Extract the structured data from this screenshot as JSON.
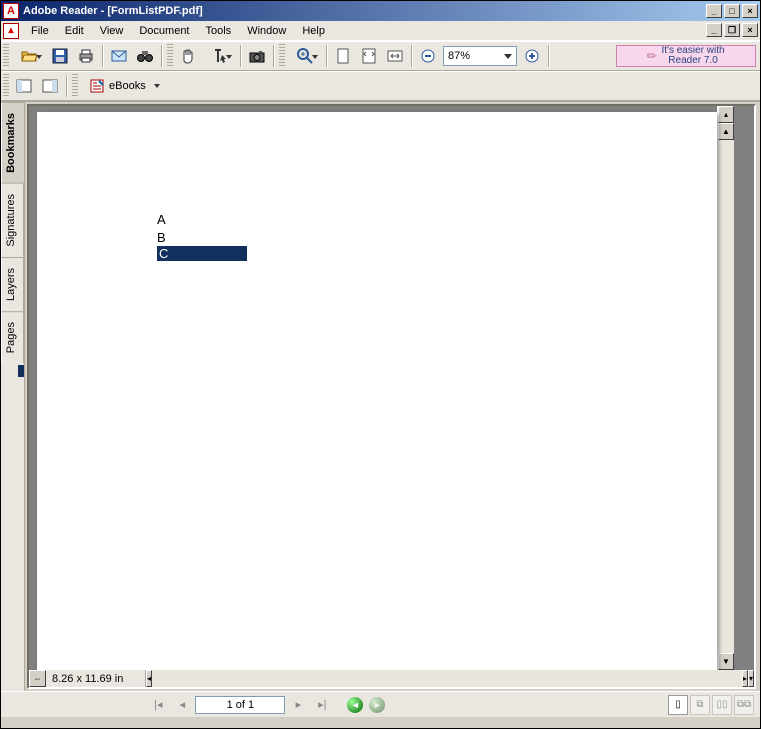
{
  "title": "Adobe Reader - [FormListPDF.pdf]",
  "menus": {
    "file": "File",
    "edit": "Edit",
    "view": "View",
    "document": "Document",
    "tools": "Tools",
    "window": "Window",
    "help": "Help"
  },
  "zoom": "87%",
  "promo": {
    "line1": "It's easier with",
    "line2": "Reader 7.0"
  },
  "ebooks_label": "eBooks",
  "nav_tabs": {
    "bookmarks": "Bookmarks",
    "signatures": "Signatures",
    "layers": "Layers",
    "pages": "Pages"
  },
  "page_size": "8.26 x 11.69 in",
  "page_indicator": "1 of 1",
  "document": {
    "items": [
      "A",
      "B",
      "C"
    ],
    "selected_index": 2
  }
}
